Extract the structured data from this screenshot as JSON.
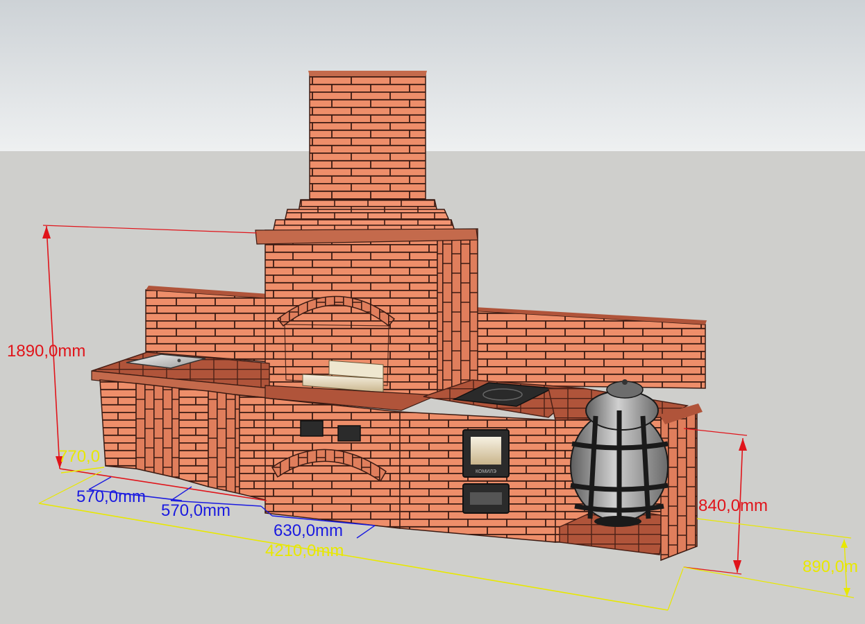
{
  "scene": {
    "sky_color": "#e4e8ea",
    "ground_color": "#cfcfcc",
    "brick_color": "#ee8e6a",
    "mortar_color": "#3a1a12",
    "objects": [
      "brick-bbq-complex",
      "chimney",
      "sink",
      "cooktop",
      "stove-door",
      "ash-door",
      "tandoor-pot"
    ]
  },
  "dimensions": {
    "height_total": "1890,0mm",
    "depth": "770,0",
    "width_bay_1": "570,0mm",
    "width_bay_2": "570,0mm",
    "width_firebox": "630,0mm",
    "length_total": "4210,0mm",
    "height_counter": "840,0mm",
    "depth_right": "890,0m"
  },
  "colors": {
    "red_dimension": "#e0141a",
    "yellow_dimension": "#e8e800",
    "blue_dimension": "#1a1ae0"
  },
  "stove_plate_text": "КОМИЛЭ"
}
